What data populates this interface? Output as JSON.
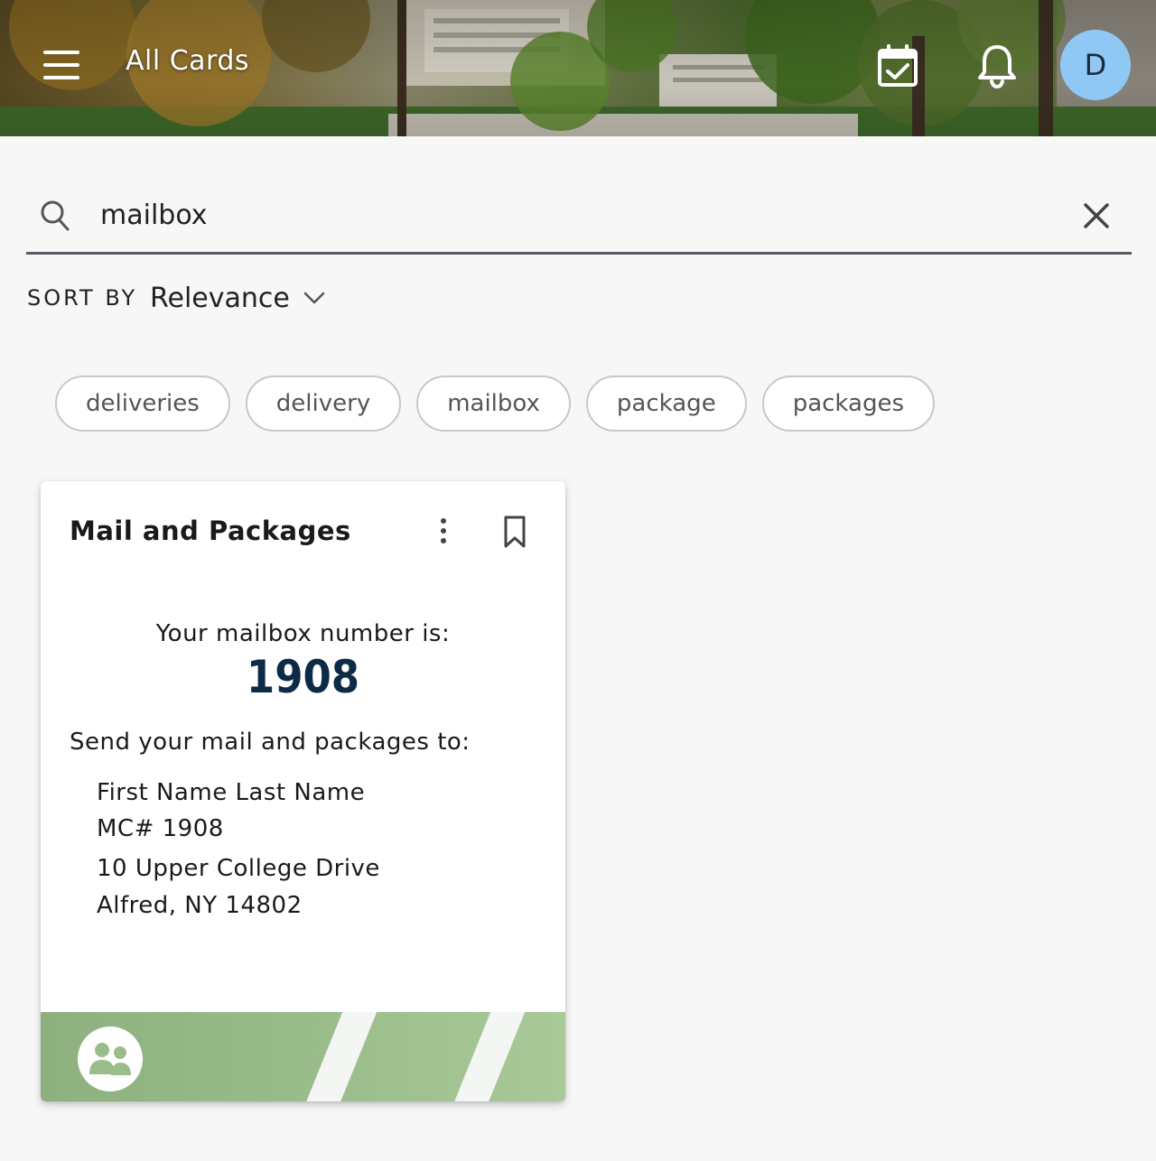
{
  "header": {
    "title": "All Cards",
    "menu_icon": "hamburger-menu-icon",
    "calendar_icon": "calendar-check-icon",
    "notification_icon": "bell-icon",
    "avatar_initial": "D"
  },
  "search": {
    "value": "mailbox",
    "search_icon": "search-icon",
    "clear_icon": "close-icon"
  },
  "sort": {
    "label": "SORT BY",
    "selected": "Relevance"
  },
  "chips": [
    {
      "label": "deliveries"
    },
    {
      "label": "delivery"
    },
    {
      "label": "mailbox"
    },
    {
      "label": "package"
    },
    {
      "label": "packages"
    }
  ],
  "card": {
    "title": "Mail and Packages",
    "mailbox_label": "Your mailbox number is:",
    "mailbox_number": "1908",
    "send_label": "Send your mail and packages to:",
    "address": {
      "name": "First Name Last Name",
      "mc": "MC# 1908",
      "street": "10 Upper College Drive",
      "city": "Alfred, NY 14802"
    },
    "footer_icon": "group-users-icon"
  },
  "colors": {
    "background": "#f7f7f7",
    "avatar": "#90c8f5",
    "mailbox_number": "#0d2a47",
    "footer_green": "#9bbd8b"
  }
}
